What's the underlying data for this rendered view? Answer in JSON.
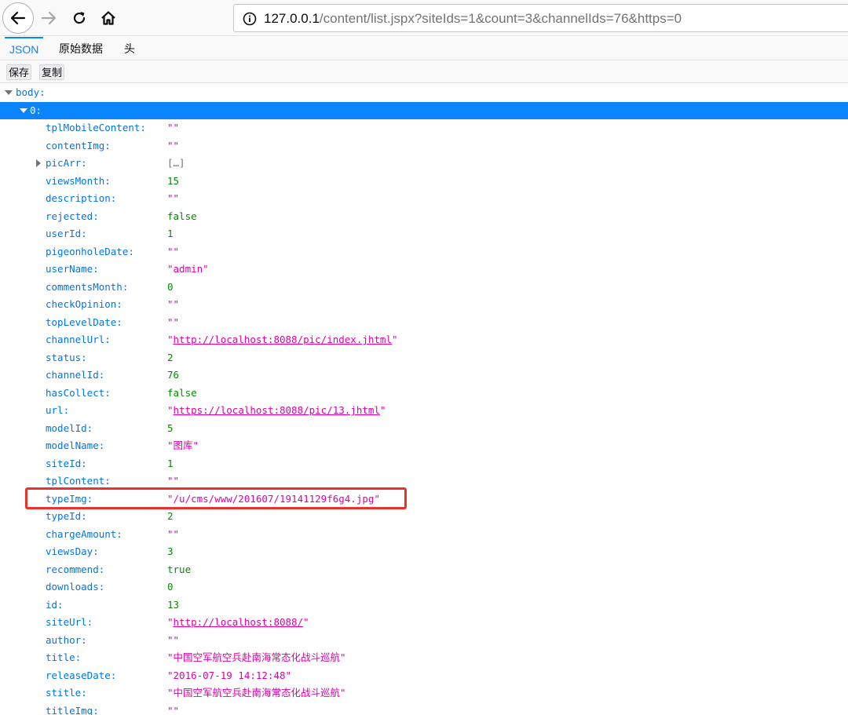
{
  "browser": {
    "url_host": "127.0.0.1",
    "url_rest": "/content/list.jspx?siteIds=1&count=3&channelIds=76&https=0",
    "icons": [
      "back-arrow-icon",
      "forward-arrow-icon",
      "reload-icon",
      "home-icon",
      "info-icon"
    ]
  },
  "viewer": {
    "tabs": [
      "JSON",
      "原始数据",
      "头"
    ],
    "actions": {
      "save": "保存",
      "copy": "复制"
    }
  },
  "tree": {
    "root_key": "body:",
    "index_key": "0:",
    "rows": [
      {
        "key": "tplMobileContent:",
        "value": "\"\"",
        "type": "str"
      },
      {
        "key": "contentImg:",
        "value": "\"\"",
        "type": "str"
      },
      {
        "key": "picArr:",
        "value": "[…]",
        "type": "obj"
      },
      {
        "key": "viewsMonth:",
        "value": "15",
        "type": "num"
      },
      {
        "key": "description:",
        "value": "\"\"",
        "type": "str"
      },
      {
        "key": "rejected:",
        "value": "false",
        "type": "bool"
      },
      {
        "key": "userId:",
        "value": "1",
        "type": "num"
      },
      {
        "key": "pigeonholeDate:",
        "value": "\"\"",
        "type": "str"
      },
      {
        "key": "userName:",
        "value": "\"admin\"",
        "type": "str"
      },
      {
        "key": "commentsMonth:",
        "value": "0",
        "type": "num"
      },
      {
        "key": "checkOpinion:",
        "value": "\"\"",
        "type": "str"
      },
      {
        "key": "topLevelDate:",
        "value": "\"\"",
        "type": "str"
      },
      {
        "key": "channelUrl:",
        "value": "http://localhost:8088/pic/index.jhtml",
        "type": "link"
      },
      {
        "key": "status:",
        "value": "2",
        "type": "num"
      },
      {
        "key": "channelId:",
        "value": "76",
        "type": "num"
      },
      {
        "key": "hasCollect:",
        "value": "false",
        "type": "bool"
      },
      {
        "key": "url:",
        "value": "https://localhost:8088/pic/13.jhtml",
        "type": "link"
      },
      {
        "key": "modelId:",
        "value": "5",
        "type": "num"
      },
      {
        "key": "modelName:",
        "value": "\"图库\"",
        "type": "str"
      },
      {
        "key": "siteId:",
        "value": "1",
        "type": "num"
      },
      {
        "key": "tplContent:",
        "value": "\"\"",
        "type": "str"
      },
      {
        "key": "typeImg:",
        "value": "\"/u/cms/www/201607/19141129f6g4.jpg\"",
        "type": "str"
      },
      {
        "key": "typeId:",
        "value": "2",
        "type": "num"
      },
      {
        "key": "chargeAmount:",
        "value": "\"\"",
        "type": "str"
      },
      {
        "key": "viewsDay:",
        "value": "3",
        "type": "num"
      },
      {
        "key": "recommend:",
        "value": "true",
        "type": "bool"
      },
      {
        "key": "downloads:",
        "value": "0",
        "type": "num"
      },
      {
        "key": "id:",
        "value": "13",
        "type": "num"
      },
      {
        "key": "siteUrl:",
        "value": "http://localhost:8088/",
        "type": "link"
      },
      {
        "key": "author:",
        "value": "\"\"",
        "type": "str"
      },
      {
        "key": "title:",
        "value": "\"中国空军航空兵赴南海常态化战斗巡航\"",
        "type": "str"
      },
      {
        "key": "releaseDate:",
        "value": "\"2016-07-19 14:12:48\"",
        "type": "str"
      },
      {
        "key": "stitle:",
        "value": "\"中国空军航空兵赴南海常态化战斗巡航\"",
        "type": "str"
      },
      {
        "key": "titleImg:",
        "value": "\"\"",
        "type": "str"
      }
    ]
  },
  "annotation": {
    "highlight_color": "#e8322d",
    "highlighted_key": "typeImg:"
  }
}
